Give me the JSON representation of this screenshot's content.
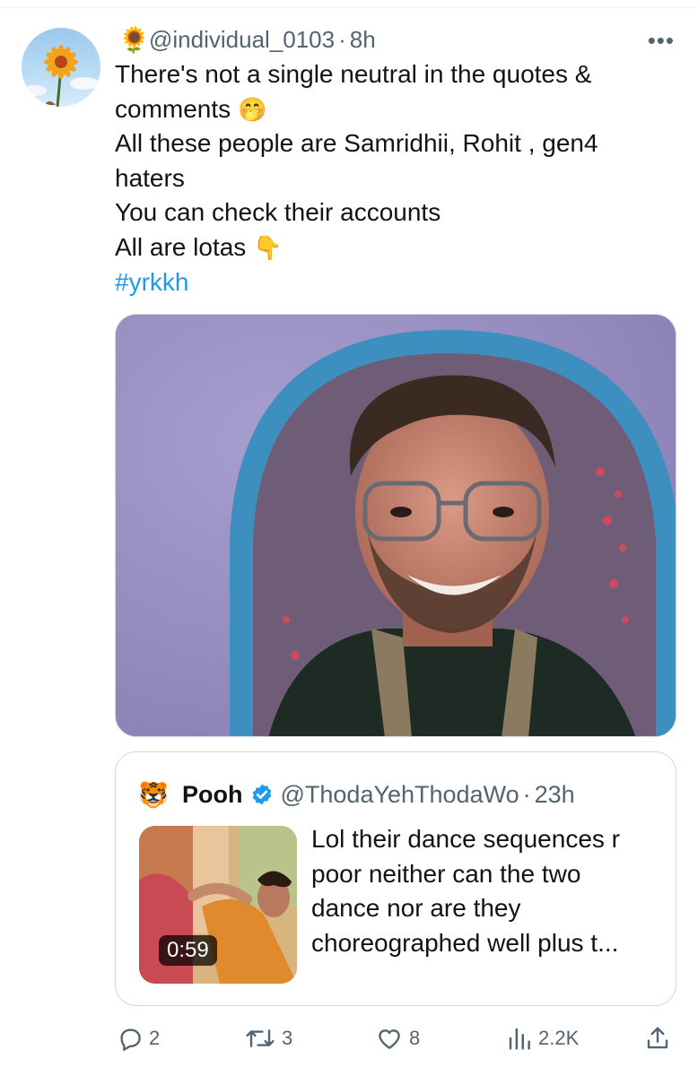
{
  "tweet": {
    "author_emoji": "🌻",
    "handle": "@individual_0103",
    "separator": "·",
    "time": "8h",
    "more_label": "•••",
    "lines": [
      "There's not a single neutral in the quotes &",
      "comments",
      "All these people are Samridhii, Rohit , gen4",
      "haters",
      "You can check their accounts",
      "All are lotas"
    ],
    "emoji_after_comments": "🤭",
    "emoji_after_lotas": "👇",
    "hashtag": "#yrkkh"
  },
  "quoted_tweet": {
    "avatar_emoji": "🐯",
    "name": "Pooh",
    "handle": "@ThodaYehThodaWo",
    "separator": "·",
    "time": "23h",
    "video_duration": "0:59",
    "text_lines": [
      "Lol their dance sequences r",
      "poor neither can the two",
      "dance nor are they",
      "choreographed well plus t..."
    ]
  },
  "actions": {
    "replies": "2",
    "retweets": "3",
    "likes": "8",
    "views": "2.2K"
  },
  "colors": {
    "link": "#1d9bf0",
    "secondary_text": "#536471",
    "primary_text": "#0f1419",
    "border": "#cfd9de"
  },
  "icons": [
    "more-icon",
    "verified-badge-icon",
    "reply-icon",
    "retweet-icon",
    "like-icon",
    "views-icon",
    "share-icon"
  ]
}
